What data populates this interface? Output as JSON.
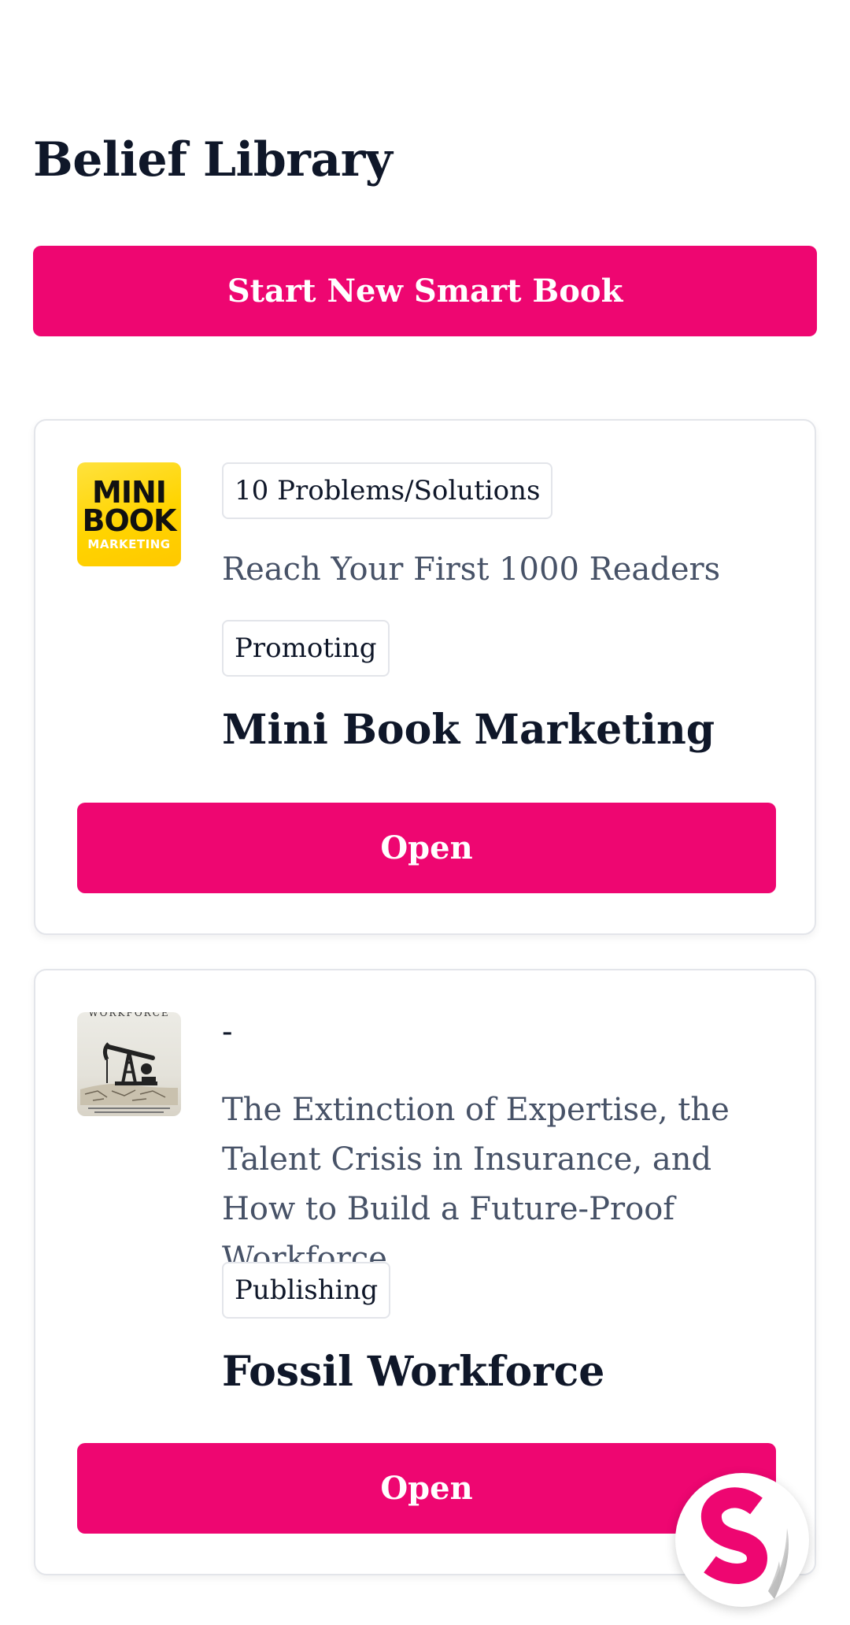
{
  "header": {
    "title": "Belief Library"
  },
  "actions": {
    "start_label": "Start New Smart Book"
  },
  "books": [
    {
      "cover": {
        "line1": "MINI",
        "line2": "BOOK",
        "line3": "MARKETING"
      },
      "category": "10 Problems/Solutions",
      "subtitle": "Reach Your First 1000 Readers",
      "status": "Promoting",
      "title": "Mini Book Marketing",
      "open_label": "Open"
    },
    {
      "cover": {
        "line1": "WORKFORCE"
      },
      "category": "-",
      "subtitle": "The Extinction of Expertise, the Talent Crisis in Insurance, and How to Build a Future-Proof Workforce",
      "status": "Publishing",
      "title": "Fossil Workforce",
      "open_label": "Open"
    }
  ],
  "colors": {
    "accent": "#ee0671",
    "text_primary": "#0f1729",
    "text_secondary": "#475267",
    "border": "#e3e5ea"
  },
  "fab": {
    "icon": "s-logo-icon"
  }
}
